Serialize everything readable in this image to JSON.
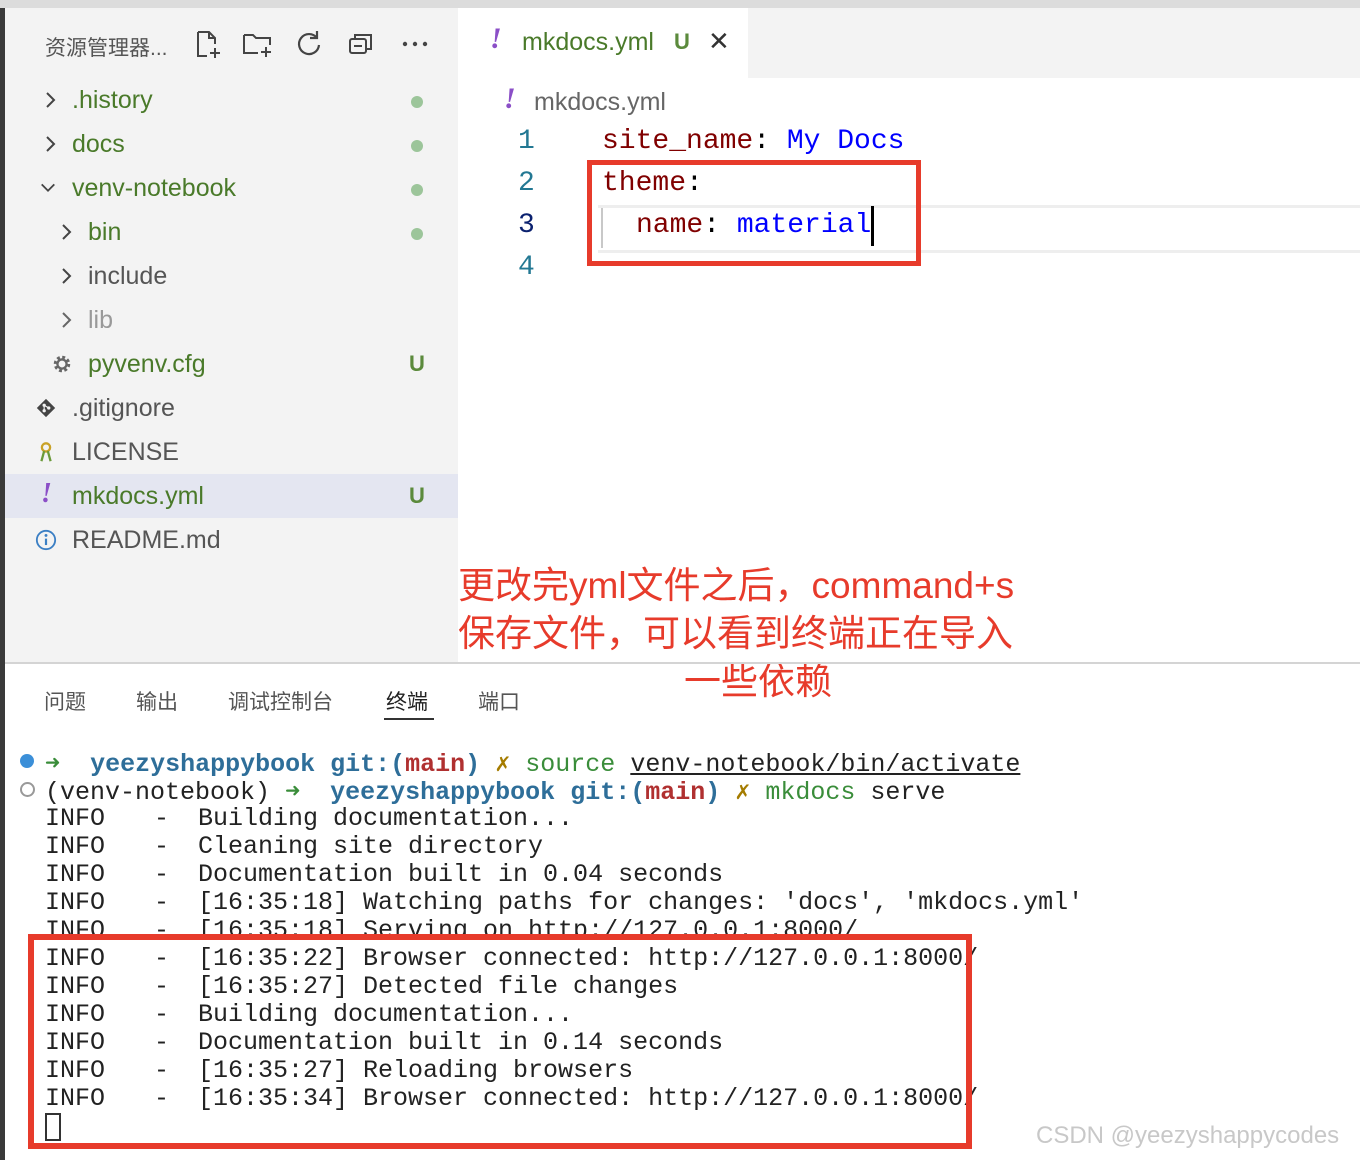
{
  "explorer": {
    "title": "资源管理器...",
    "items": [
      {
        "label": ".history",
        "color": "#4a7a2a"
      },
      {
        "label": "docs",
        "color": "#4a7a2a"
      },
      {
        "label": "venv-notebook",
        "color": "#4a7a2a"
      },
      {
        "label": "bin",
        "color": "#4a7a2a"
      },
      {
        "label": "include",
        "color": "#555555"
      },
      {
        "label": "lib",
        "color": "#999999"
      },
      {
        "label": "pyvenv.cfg",
        "badge": "U",
        "color": "#4a7a2a"
      },
      {
        "label": ".gitignore",
        "color": "#555555"
      },
      {
        "label": "LICENSE",
        "color": "#555555"
      },
      {
        "label": "mkdocs.yml",
        "badge": "U",
        "color": "#4a7a2a"
      },
      {
        "label": "README.md",
        "color": "#555555"
      }
    ]
  },
  "editor": {
    "tab": {
      "icon": "!",
      "name": "mkdocs.yml",
      "badge": "U",
      "close": "✕"
    },
    "breadcrumb": {
      "icon": "!",
      "name": "mkdocs.yml"
    },
    "line_numbers": [
      "1",
      "2",
      "3",
      "4"
    ],
    "lines": [
      {
        "key": "site_name",
        "sep": ": ",
        "value": "My Docs"
      },
      {
        "key": "theme",
        "sep": ":",
        "value": ""
      },
      {
        "key": "name",
        "sep": ": ",
        "value": "material"
      }
    ]
  },
  "annotation": {
    "lines": [
      "更改完yml文件之后，command+s",
      "保存文件，可以看到终端正在导入",
      "一些依赖"
    ]
  },
  "panel": {
    "tabs": [
      "问题",
      "输出",
      "调试控制台",
      "终端",
      "端口"
    ],
    "active_tab": "终端"
  },
  "terminal": {
    "prompt1": {
      "arrow": "➜",
      "user": "yeezyshappybook",
      "git": "git:(",
      "branch": "main",
      "git_close": ")",
      "x": "✗",
      "cmd": "source",
      "arg": "venv-notebook/bin/activate"
    },
    "prompt2": {
      "venv": "(venv-notebook)",
      "arrow": "➜",
      "user": "yeezyshappybook",
      "git": "git:(",
      "branch": "main",
      "git_close": ")",
      "x": "✗",
      "cmd": "mkdocs",
      "arg": "serve"
    },
    "logs": [
      {
        "level": "INFO",
        "dash": "-",
        "msg": "Building documentation..."
      },
      {
        "level": "INFO",
        "dash": "-",
        "msg": "Cleaning site directory"
      },
      {
        "level": "INFO",
        "dash": "-",
        "msg": "Documentation built in 0.04 seconds"
      },
      {
        "level": "INFO",
        "dash": "-",
        "msg": "[16:35:18] Watching paths for changes: 'docs', 'mkdocs.yml'"
      },
      {
        "level": "INFO",
        "dash": "-",
        "msg": "[16:35:18] Serving on http://127.0.0.1:8000/"
      },
      {
        "level": "INFO",
        "dash": "-",
        "msg": "[16:35:22] Browser connected: http://127.0.0.1:8000/"
      },
      {
        "level": "INFO",
        "dash": "-",
        "msg": "[16:35:27] Detected file changes"
      },
      {
        "level": "INFO",
        "dash": "-",
        "msg": "Building documentation..."
      },
      {
        "level": "INFO",
        "dash": "-",
        "msg": "Documentation built in 0.14 seconds"
      },
      {
        "level": "INFO",
        "dash": "-",
        "msg": "[16:35:27] Reloading browsers"
      },
      {
        "level": "INFO",
        "dash": "-",
        "msg": "[16:35:34] Browser connected: http://127.0.0.1:8000/"
      }
    ]
  },
  "watermark": "CSDN @yeezyshappycodes",
  "colors": {
    "highlight_red": "#e73b2b",
    "git_green": "#4a7a2a",
    "yaml_key": "#800000",
    "yaml_value": "#0000ff"
  }
}
